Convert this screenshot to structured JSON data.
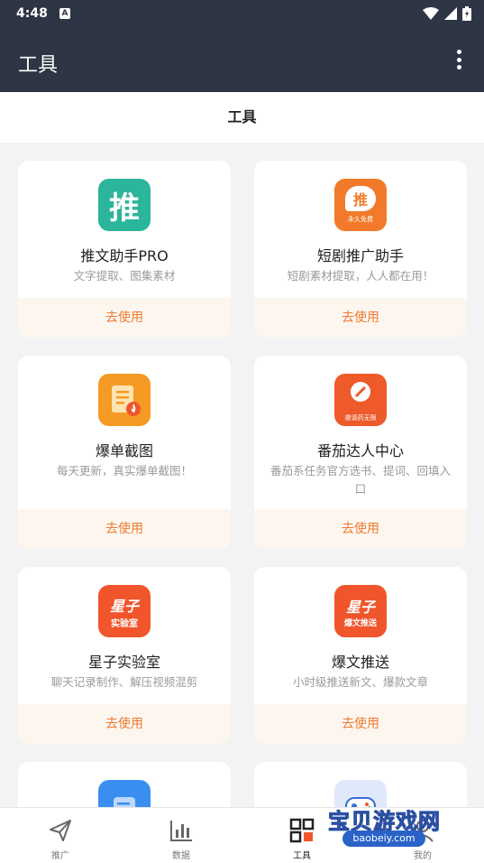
{
  "status_bar": {
    "time": "4:48",
    "notification_badge": "A"
  },
  "app_bar": {
    "title": "工具"
  },
  "tab": {
    "title": "工具"
  },
  "tools": [
    {
      "icon_text": "推",
      "icon": "tui-icon",
      "color": "#2bb59a",
      "name": "推文助手PRO",
      "desc": "文字提取、图集素材",
      "action": "去使用"
    },
    {
      "icon_text": "推",
      "icon_sub": "永久免费",
      "icon": "short-drama-icon",
      "color": "#f27a2a",
      "name": "短剧推广助手",
      "desc": "短剧素材提取，人人都在用！",
      "action": "去使用"
    },
    {
      "icon": "document-fire-icon",
      "color": "#f59a22",
      "name": "爆单截图",
      "desc": "每天更新，真实爆单截图！",
      "action": "去使用"
    },
    {
      "icon_sub": "邀请药无限",
      "icon": "tomato-icon",
      "color": "#ee5a2a",
      "name": "番茄达人中心",
      "desc": "番茄系任务官方选书、提词、回填入口",
      "action": "去使用"
    },
    {
      "icon_text": "星子",
      "icon_sub": "实验室",
      "icon": "xingzi-lab-icon",
      "color": "#f0552c",
      "name": "星子实验室",
      "desc": "聊天记录制作、解压视频混剪",
      "action": "去使用"
    },
    {
      "icon_text": "星子",
      "icon_sub": "爆文推送",
      "icon": "xingzi-push-icon",
      "color": "#f0552c",
      "name": "爆文推送",
      "desc": "小时级推送新文、爆款文章",
      "action": "去使用"
    },
    {
      "icon": "chat-doc-icon",
      "color": "#3a8ef0",
      "name": "",
      "desc": "",
      "action": ""
    },
    {
      "icon": "game-controller-icon",
      "color": "#dfe9fb",
      "name": "",
      "desc": "",
      "action": ""
    }
  ],
  "bottom_nav": [
    {
      "label": "推广",
      "icon": "send-icon",
      "active": false
    },
    {
      "label": "数据",
      "icon": "bar-chart-icon",
      "active": false
    },
    {
      "label": "工具",
      "icon": "grid-icon",
      "active": true
    },
    {
      "label": "我的",
      "icon": "user-icon",
      "active": false
    }
  ],
  "watermark": {
    "text": "宝贝游戏网",
    "url": "baobeiy.com"
  }
}
